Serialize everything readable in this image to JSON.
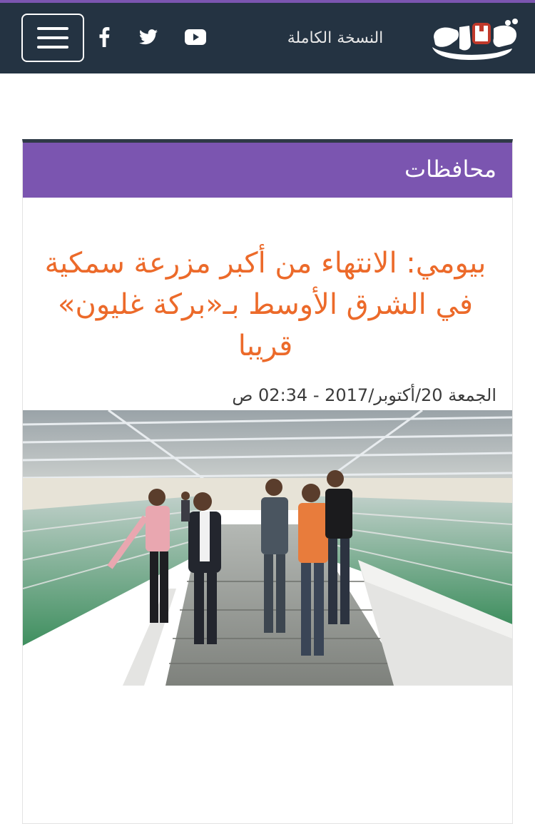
{
  "header": {
    "menu_icon": "hamburger-menu-icon",
    "social": [
      {
        "name": "facebook-icon"
      },
      {
        "name": "twitter-icon"
      },
      {
        "name": "youtube-icon"
      }
    ],
    "full_version_label": "النسخة الكاملة",
    "logo_alt": "فيتو"
  },
  "section": {
    "title": "محافظات"
  },
  "article": {
    "headline": "بيومي: الانتهاء من أكبر مزرعة سمكية في الشرق الأوسط بـ«بركة غليون» قريبا",
    "date": "الجمعة 20/أكتوبر/2017 - 02:34 ص",
    "image_description": "fish-farm-photo"
  },
  "colors": {
    "header_bg": "#243342",
    "accent_purple": "#7b55b0",
    "headline_orange": "#ec6a2a"
  }
}
